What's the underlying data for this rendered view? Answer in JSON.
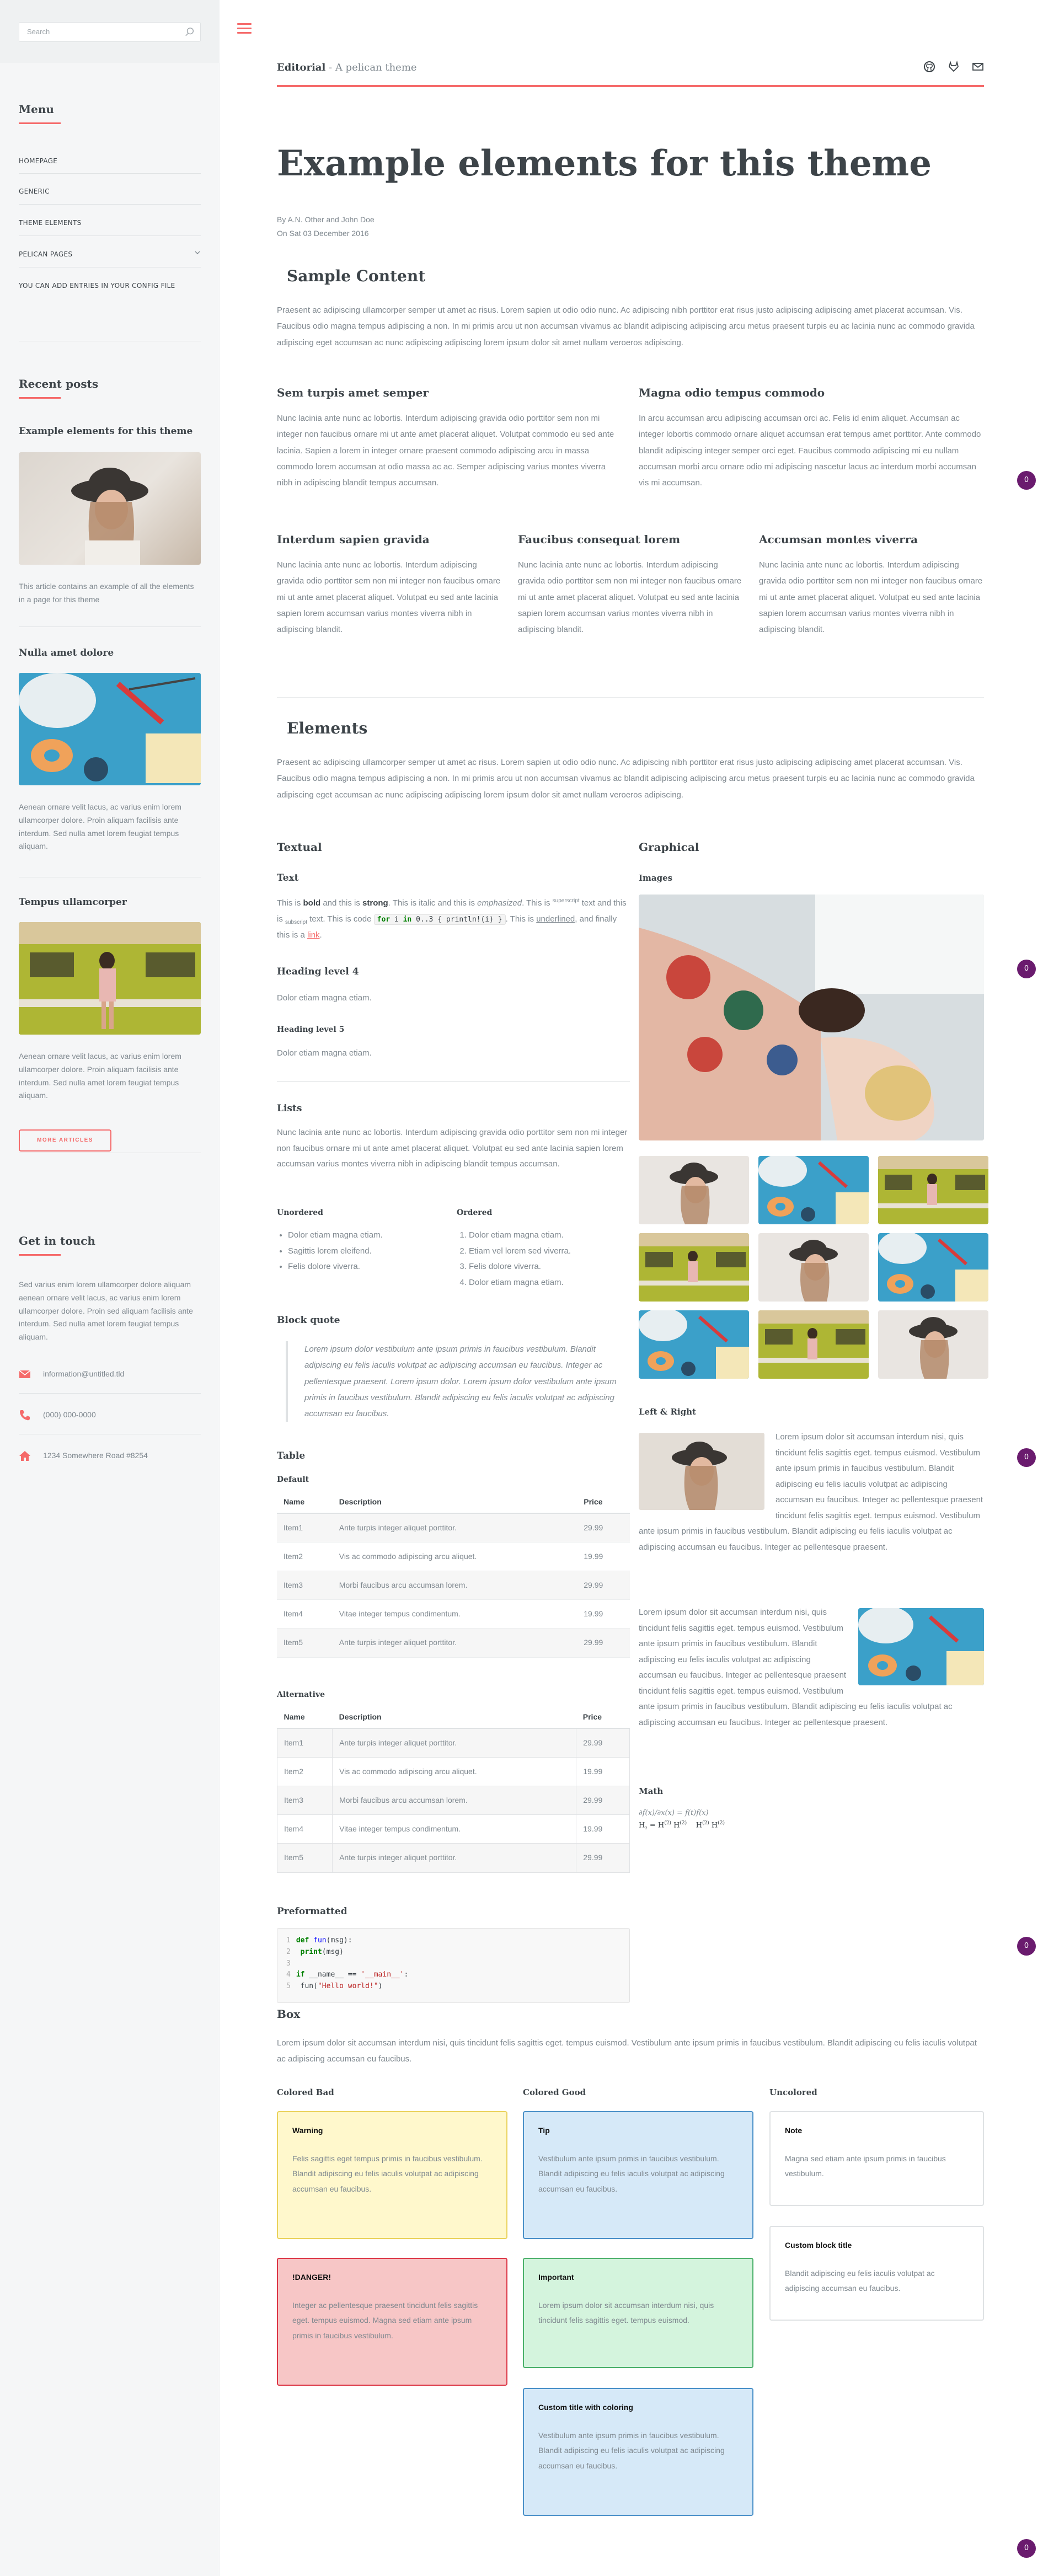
{
  "sidebar": {
    "search_placeholder": "Search",
    "menu_heading": "Menu",
    "menu_items": [
      "HOMEPAGE",
      "GENERIC",
      "THEME ELEMENTS",
      "PELICAN PAGES",
      "YOU CAN ADD ENTRIES IN YOUR CONFIG FILE"
    ],
    "recent_heading": "Recent posts",
    "posts": [
      {
        "title": "Example elements for this theme",
        "excerpt": "This article contains an example of all the elements in a page for this theme"
      },
      {
        "title": "Nulla amet dolore",
        "excerpt": "Aenean ornare velit lacus, ac varius enim lorem ullamcorper dolore. Proin aliquam facilisis ante interdum. Sed nulla amet lorem feugiat tempus aliquam."
      },
      {
        "title": "Tempus ullamcorper",
        "excerpt": "Aenean ornare velit lacus, ac varius enim lorem ullamcorper dolore. Proin aliquam facilisis ante interdum. Sed nulla amet lorem feugiat tempus aliquam."
      }
    ],
    "more_button": "MORE ARTICLES",
    "contact_heading": "Get in touch",
    "contact_text": "Sed varius enim lorem ullamcorper dolore aliquam aenean ornare velit lacus, ac varius enim lorem ullamcorper dolore. Proin sed aliquam facilisis ante interdum. Sed nulla amet lorem feugiat tempus aliquam.",
    "email": "information@untitled.tld",
    "phone": "(000) 000-0000",
    "address": "1234 Somewhere Road #8254"
  },
  "header": {
    "brand": "Editorial",
    "tagline": " - A pelican theme"
  },
  "page": {
    "title": "Example elements for this theme",
    "by": "By A.N. Other and John Doe",
    "date": "On Sat 03 December 2016"
  },
  "sample": {
    "heading": "Sample Content",
    "intro": "Praesent ac adipiscing ullamcorper semper ut amet ac risus. Lorem sapien ut odio odio nunc. Ac adipiscing nibh porttitor erat risus justo adipiscing adipiscing amet placerat accumsan. Vis. Faucibus odio magna tempus adipiscing a non. In mi primis arcu ut non accumsan vivamus ac blandit adipiscing adipiscing arcu metus praesent turpis eu ac lacinia nunc ac commodo gravida adipiscing eget accumsan ac nunc adipiscing adipiscing lorem ipsum dolor sit amet nullam veroeros adipiscing.",
    "two_col": [
      {
        "title": "Sem turpis amet semper",
        "text": "Nunc lacinia ante nunc ac lobortis. Interdum adipiscing gravida odio porttitor sem non mi integer non faucibus ornare mi ut ante amet placerat aliquet. Volutpat commodo eu sed ante lacinia. Sapien a lorem in integer ornare praesent commodo adipiscing arcu in massa commodo lorem accumsan at odio massa ac ac. Semper adipiscing varius montes viverra nibh in adipiscing blandit tempus accumsan."
      },
      {
        "title": "Magna odio tempus commodo",
        "text": "In arcu accumsan arcu adipiscing accumsan orci ac. Felis id enim aliquet. Accumsan ac integer lobortis commodo ornare aliquet accumsan erat tempus amet porttitor. Ante commodo blandit adipiscing integer semper orci eget. Faucibus commodo adipiscing mi eu nullam accumsan morbi arcu ornare odio mi adipiscing nascetur lacus ac interdum morbi accumsan vis mi accumsan."
      }
    ],
    "three_col": [
      {
        "title": "Interdum sapien gravida",
        "text": "Nunc lacinia ante nunc ac lobortis. Interdum adipiscing gravida odio porttitor sem non mi integer non faucibus ornare mi ut ante amet placerat aliquet. Volutpat eu sed ante lacinia sapien lorem accumsan varius montes viverra nibh in adipiscing blandit."
      },
      {
        "title": "Faucibus consequat lorem",
        "text": "Nunc lacinia ante nunc ac lobortis. Interdum adipiscing gravida odio porttitor sem non mi integer non faucibus ornare mi ut ante amet placerat aliquet. Volutpat eu sed ante lacinia sapien lorem accumsan varius montes viverra nibh in adipiscing blandit."
      },
      {
        "title": "Accumsan montes viverra",
        "text": "Nunc lacinia ante nunc ac lobortis. Interdum adipiscing gravida odio porttitor sem non mi integer non faucibus ornare mi ut ante amet placerat aliquet. Volutpat eu sed ante lacinia sapien lorem accumsan varius montes viverra nibh in adipiscing blandit."
      }
    ]
  },
  "elements": {
    "heading": "Elements",
    "intro": "Praesent ac adipiscing ullamcorper semper ut amet ac risus. Lorem sapien ut odio odio nunc. Ac adipiscing nibh porttitor erat risus justo adipiscing adipiscing amet placerat accumsan. Vis. Faucibus odio magna tempus adipiscing a non. In mi primis arcu ut non accumsan vivamus ac blandit adipiscing adipiscing arcu metus praesent turpis eu ac lacinia nunc ac commodo gravida adipiscing eget accumsan ac nunc adipiscing adipiscing lorem ipsum dolor sit amet nullam veroeros adipiscing.",
    "textual": "Textual",
    "graphical": "Graphical",
    "text_h": "Text",
    "h4": "Heading level 4",
    "h4_text": "Dolor etiam magna etiam.",
    "h5": "Heading level 5",
    "h5_text": "Dolor etiam magna etiam.",
    "lists_h": "Lists",
    "lists_text": "Nunc lacinia ante nunc ac lobortis. Interdum adipiscing gravida odio porttitor sem non mi integer non faucibus ornare mi ut ante amet placerat aliquet. Volutpat eu sed ante lacinia sapien lorem accumsan varius montes viverra nibh in adipiscing blandit tempus accumsan.",
    "unordered_h": "Unordered",
    "unordered": [
      "Dolor etiam magna etiam.",
      "Sagittis lorem eleifend.",
      "Felis dolore viverra."
    ],
    "ordered_h": "Ordered",
    "ordered": [
      "Dolor etiam magna etiam.",
      "Etiam vel lorem sed viverra.",
      "Felis dolore viverra.",
      "Dolor etiam magna etiam."
    ],
    "blockquote_h": "Block quote",
    "blockquote": "Lorem ipsum dolor vestibulum ante ipsum primis in faucibus vestibulum. Blandit adipiscing eu felis iaculis volutpat ac adipiscing accumsan eu faucibus. Integer ac pellentesque praesent. Lorem ipsum dolor. Lorem ipsum dolor vestibulum ante ipsum primis in faucibus vestibulum. Blandit adipiscing eu felis iaculis volutpat ac adipiscing accumsan eu faucibus.",
    "table_h": "Table",
    "default_h": "Default",
    "alt_h": "Alternative",
    "table_cols": [
      "Name",
      "Description",
      "Price"
    ],
    "table_rows": [
      [
        "Item1",
        "Ante turpis integer aliquet porttitor.",
        "29.99"
      ],
      [
        "Item2",
        "Vis ac commodo adipiscing arcu aliquet.",
        "19.99"
      ],
      [
        "Item3",
        "Morbi faucibus arcu accumsan lorem.",
        "29.99"
      ],
      [
        "Item4",
        "Vitae integer tempus condimentum.",
        "19.99"
      ],
      [
        "Item5",
        "Ante turpis integer aliquet porttitor.",
        "29.99"
      ]
    ],
    "pre_h": "Preformatted",
    "box_h": "Box",
    "box_text": "Lorem ipsum dolor sit accumsan interdum nisi, quis tincidunt felis sagittis eget. tempus euismod. Vestibulum ante ipsum primis in faucibus vestibulum. Blandit adipiscing eu felis iaculis volutpat ac adipiscing accumsan eu faucibus.",
    "images_h": "Images",
    "leftright_h": "Left & Right",
    "lr_text1": "Lorem ipsum dolor sit accumsan interdum nisi, quis tincidunt felis sagittis eget. tempus euismod. Vestibulum ante ipsum primis in faucibus vestibulum. Blandit adipiscing eu felis iaculis volutpat ac adipiscing accumsan eu faucibus. Integer ac pellentesque praesent tincidunt felis sagittis eget. tempus euismod. Vestibulum ante ipsum primis in faucibus vestibulum. Blandit adipiscing eu felis iaculis volutpat ac adipiscing accumsan eu faucibus. Integer ac pellentesque praesent.",
    "lr_text2": "Lorem ipsum dolor sit accumsan interdum nisi, quis tincidunt felis sagittis eget. tempus euismod. Vestibulum ante ipsum primis in faucibus vestibulum. Blandit adipiscing eu felis iaculis volutpat ac adipiscing accumsan eu faucibus. Integer ac pellentesque praesent tincidunt felis sagittis eget. tempus euismod. Vestibulum ante ipsum primis in faucibus vestibulum. Blandit adipiscing eu felis iaculis volutpat ac adipiscing accumsan eu faucibus. Integer ac pellentesque praesent.",
    "math_h": "Math"
  },
  "boxes": {
    "colored_bad": "Colored Bad",
    "colored_good": "Colored Good",
    "uncolored": "Uncolored",
    "warning": {
      "title": "Warning",
      "text": "Felis sagittis eget tempus primis in faucibus vestibulum. Blandit adipiscing eu felis iaculis volutpat ac adipiscing accumsan eu faucibus."
    },
    "danger": {
      "title": "!DANGER!",
      "text": "Integer ac pellentesque praesent tincidunt felis sagittis eget. tempus euismod. Magna sed etiam ante ipsum primis in faucibus vestibulum."
    },
    "tip": {
      "title": "Tip",
      "text": "Vestibulum ante ipsum primis in faucibus vestibulum. Blandit adipiscing eu felis iaculis volutpat ac adipiscing accumsan eu faucibus."
    },
    "important": {
      "title": "Important",
      "text": "Lorem ipsum dolor sit accumsan interdum nisi, quis tincidunt felis sagittis eget. tempus euismod."
    },
    "custom_color": {
      "title": "Custom title with coloring",
      "text": "Vestibulum ante ipsum primis in faucibus vestibulum. Blandit adipiscing eu felis iaculis volutpat ac adipiscing accumsan eu faucibus."
    },
    "note": {
      "title": "Note",
      "text": "Magna sed etiam ante ipsum primis in faucibus vestibulum."
    },
    "custom": {
      "title": "Custom block title",
      "text": "Blandit adipiscing eu felis iaculis volutpat ac adipiscing accumsan eu faucibus."
    }
  },
  "badge": "0",
  "colors": {
    "accent": "#f56a6a",
    "heading": "#3d4449",
    "text": "#7f888f",
    "sidebar": "#f5f6f7"
  }
}
